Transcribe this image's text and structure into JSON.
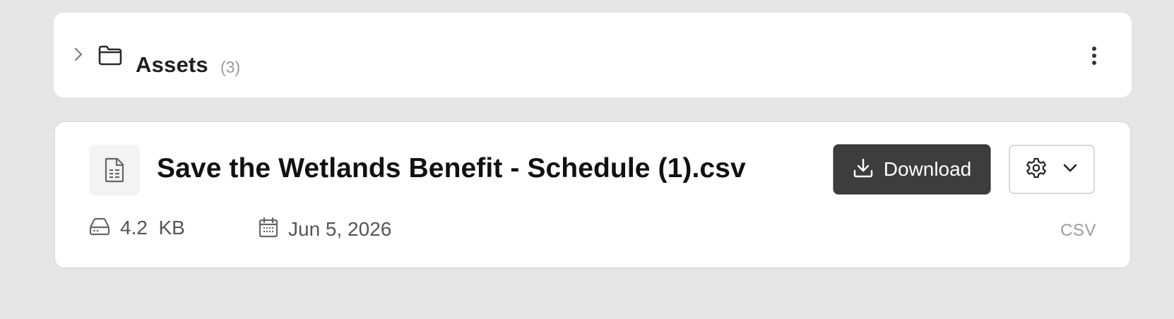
{
  "folder": {
    "title": "Assets",
    "count": "(3)",
    "icons": {
      "expand": "chevron-right-icon",
      "folder": "folder-icon",
      "menu": "kebab-menu-icon"
    }
  },
  "file": {
    "name": "Save the Wetlands Benefit - Schedule (1).csv",
    "download_label": "Download",
    "size": "4.2  KB",
    "date": "Jun 5, 2026",
    "type": "CSV",
    "icons": {
      "file": "spreadsheet-file-icon",
      "download": "download-icon",
      "settings": "gear-icon",
      "dropdown": "chevron-down-icon",
      "size": "hard-drive-icon",
      "date": "calendar-icon"
    }
  },
  "colors": {
    "page_background": "#e5e5e5",
    "card_background": "#ffffff",
    "primary_button": "#3d3d3d",
    "muted_text": "#9a9a9a"
  }
}
